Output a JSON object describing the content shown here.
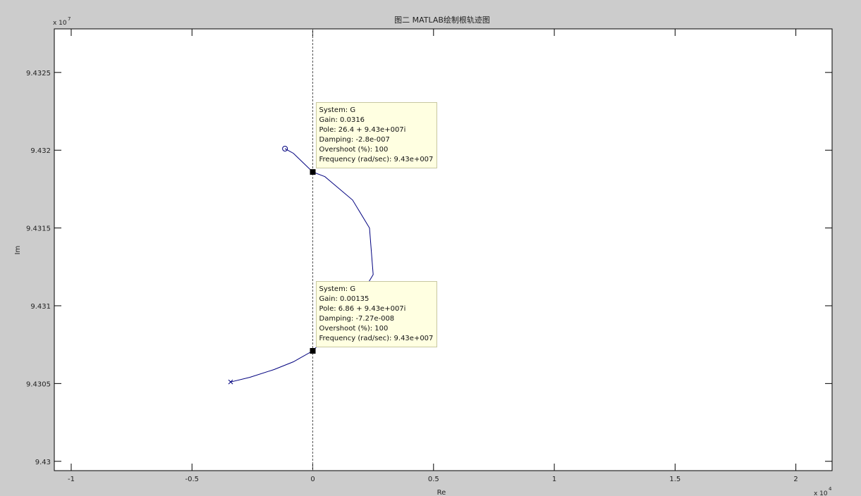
{
  "chart_data": {
    "type": "line",
    "title": "图二  MATLAB绘制根轨迹图",
    "xlabel": "Re",
    "ylabel": "Im",
    "x_multiplier": "x 10",
    "x_exponent": "4",
    "y_multiplier": "x 10",
    "y_exponent": "7",
    "xlim": [
      -1.07,
      2.15
    ],
    "ylim": [
      94299.4,
      94327.8
    ],
    "xticks": [
      -1,
      -0.5,
      0,
      0.5,
      1,
      1.5,
      2
    ],
    "xtick_labels": [
      "-1",
      "-0.5",
      "0",
      "0.5",
      "1",
      "1.5",
      "2"
    ],
    "yticks": [
      94300,
      94305,
      94310,
      94315,
      94320,
      94325
    ],
    "ytick_labels": [
      "9.43",
      "9.4305",
      "9.431",
      "9.4315",
      "9.432",
      "9.4325"
    ],
    "grid": false,
    "line_color": "#00007f",
    "background": "#ffffff",
    "figure_background": "#cccccc",
    "vertical_reference_x": 0,
    "series": [
      {
        "x": [
          -0.34,
          -0.26,
          -0.16,
          -0.08,
          0.0,
          0.1,
          0.18,
          0.25,
          0.235,
          0.165,
          0.05,
          0.0,
          -0.04,
          -0.08,
          -0.115
        ],
        "y": [
          94305.1,
          94305.4,
          94305.9,
          94306.4,
          94307.1,
          94308.7,
          94310.2,
          94312.0,
          94315.0,
          94316.8,
          94318.3,
          94318.6,
          94319.2,
          94319.8,
          94320.1
        ]
      }
    ],
    "pole": {
      "x": -0.34,
      "y": 94305.1,
      "marker": "x"
    },
    "zero": {
      "x": -0.115,
      "y": 94320.1,
      "marker": "o"
    },
    "datatips": [
      {
        "x": 0.0,
        "y": 94318.6,
        "lines": [
          "System: G",
          "Gain: 0.0316",
          "Pole: 26.4 + 9.43e+007i",
          "Damping: -2.8e-007",
          "Overshoot (%): 100",
          "Frequency (rad/sec): 9.43e+007"
        ]
      },
      {
        "x": 0.0,
        "y": 94307.1,
        "lines": [
          "System: G",
          "Gain: 0.00135",
          "Pole: 6.86 + 9.43e+007i",
          "Damping: -7.27e-008",
          "Overshoot (%): 100",
          "Frequency (rad/sec): 9.43e+007"
        ]
      }
    ]
  }
}
